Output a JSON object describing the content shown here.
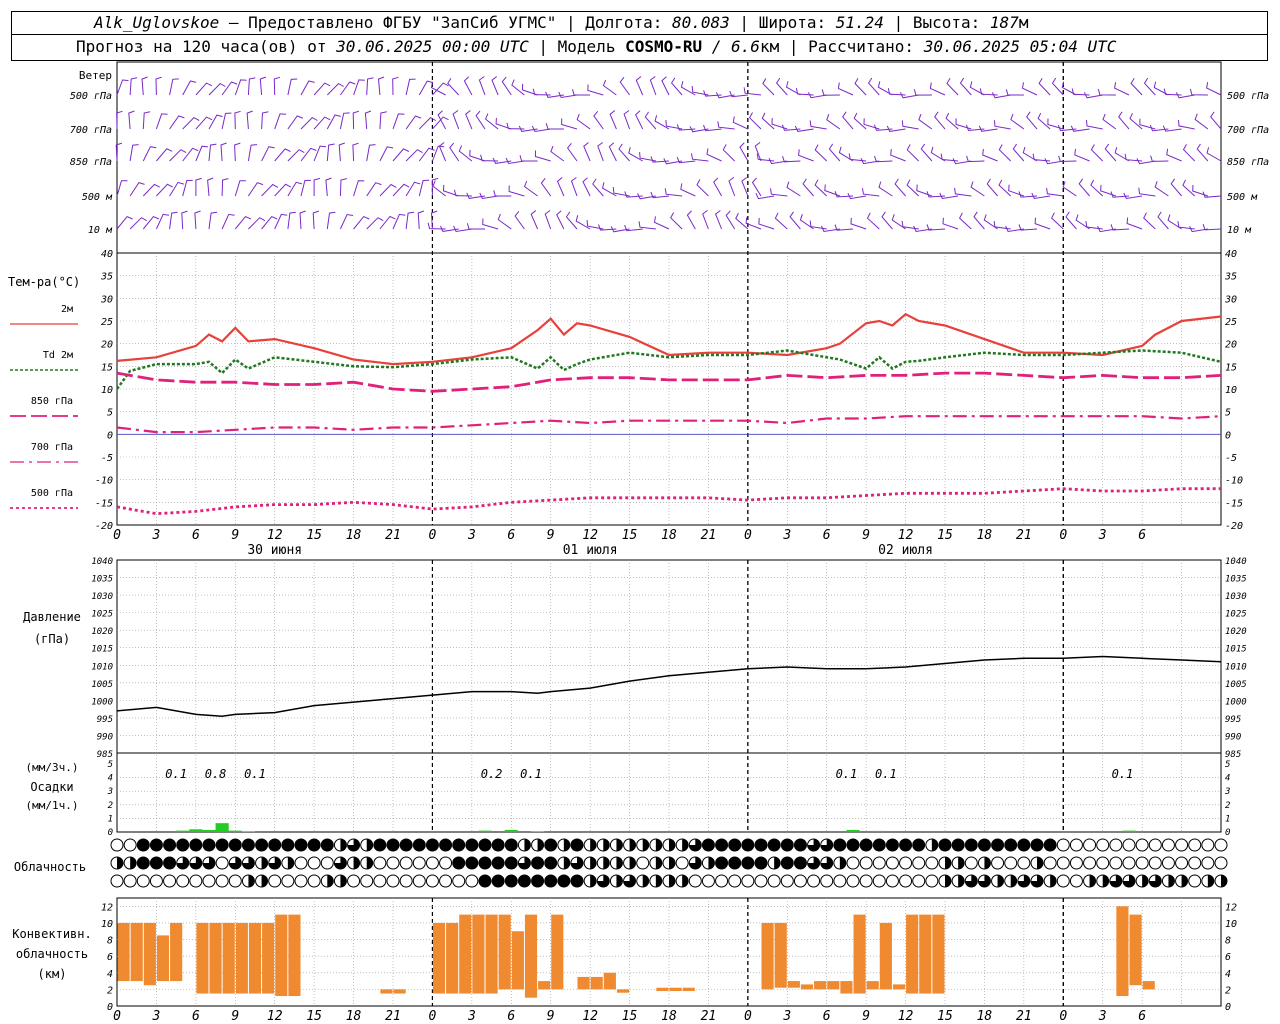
{
  "header": {
    "station": "Alk_Uglovskoe",
    "dash": " – ",
    "provider": "Предоставлено ФГБУ \"ЗапСиб УГМС\"",
    "sep": " | ",
    "lon_label": "Долгота: ",
    "lon_value": "80.083",
    "lat_label": "Широта: ",
    "lat_value": "51.24",
    "alt_label": "Высота: ",
    "alt_value": "187",
    "alt_unit": "м"
  },
  "subheader": {
    "forecast_prefix": "Прогноз на 120 часа(ов) от ",
    "run_time": "30.06.2025 00:00 UTC",
    "model_label": "  | Модель ",
    "model_name": "COSMO-RU",
    "model_res": " / 6.6",
    "model_res_unit": "км",
    "calc_label": " | Рассчитано: ",
    "calc_time": "30.06.2025 05:04 UTC"
  },
  "colors": {
    "wind": "#7a28c8",
    "t2m": "#e8403a",
    "td2m": "#1f7a1f",
    "t850": "#e0207a",
    "t700": "#e0207a",
    "t500": "#e0207a",
    "zero_line": "#4040c0",
    "pressure": "#000000",
    "precip": "#22cc22",
    "convective": "#f08a30",
    "grid": "#9a9a9a"
  },
  "time_axis": {
    "hour_ticks": [
      "0",
      "3",
      "6",
      "9",
      "12",
      "15",
      "18",
      "21",
      "0",
      "3",
      "6",
      "9",
      "12",
      "15",
      "18",
      "21",
      "0",
      "3",
      "6",
      "9",
      "12",
      "15",
      "18",
      "21",
      "0",
      "3",
      "6"
    ],
    "day_labels": [
      "30 июня",
      "01 июля",
      "02 июля"
    ]
  },
  "wind_panel": {
    "title": "Ветер",
    "levels": [
      "500 гПа",
      "700 гПа",
      "850 гПа",
      "500  м",
      "10  м"
    ],
    "icons": [
      "wind-barbs-icon"
    ]
  },
  "temp_panel": {
    "title": "Тем-ра(°C)",
    "legend": [
      {
        "key": "t2m",
        "label": "2м"
      },
      {
        "key": "td2m",
        "label_prefix": "Td",
        "label": " 2м"
      },
      {
        "key": "t850",
        "label": "850 гПа"
      },
      {
        "key": "t700",
        "label": "700 гПа"
      },
      {
        "key": "t500",
        "label": "500 гПа"
      }
    ],
    "yticks": [
      "40",
      "35",
      "30",
      "25",
      "20",
      "15",
      "10",
      "5",
      "0",
      "-5",
      "-10",
      "-15",
      "-20"
    ]
  },
  "pressure_panel": {
    "title1": "Давление",
    "title2": "(гПа)",
    "yticks": [
      "1040",
      "1035",
      "1030",
      "1025",
      "1020",
      "1015",
      "1010",
      "1005",
      "1000",
      "995",
      "990",
      "985"
    ]
  },
  "precip_panel": {
    "title1": "(мм/3ч.)",
    "title2": "Осадки",
    "title3": "(мм/1ч.)",
    "yticks": [
      "5",
      "4",
      "3",
      "2",
      "1",
      "0"
    ],
    "annotations": [
      {
        "hour": 4.5,
        "text": "0.1"
      },
      {
        "hour": 7.5,
        "text": "0.8"
      },
      {
        "hour": 10.5,
        "text": "0.1"
      },
      {
        "hour": 28.5,
        "text": "0.2"
      },
      {
        "hour": 31.5,
        "text": "0.1"
      },
      {
        "hour": 55.5,
        "text": "0.1"
      },
      {
        "hour": 58.5,
        "text": "0.1"
      },
      {
        "hour": 76.5,
        "text": "0.1"
      }
    ]
  },
  "cloud_panel": {
    "title": "Облачность",
    "rows": [
      "OOFFFFFFFFFFFFFFFHCHFFFFFFFFFFFHHFHFHHHHHHHHCFFFFFFFFCCFFFFFFFHFFFFFFFFFOOOOOOOOOOOO",
      "HHFFFCCCOCCHCHOOOCHHOOOOOOFFFFFCFFHCHHHHOHHOCHFFFFHFFCCHOOOOOOOHHOHOOOHOOOOOOOOOOOOOOC",
      "OOOOOOOOOOHHOOOOHHOOOOOOOOOOFFFFFFFFHCHCHHHHOOOOOOOOOOOOOOOOOOOHHCCHHCCHOOHHCCHCHHOHHFF"
    ]
  },
  "conv_panel": {
    "title1": "Конвективн.",
    "title2": "облачность",
    "title3": "(км)",
    "yticks": [
      "12",
      "10",
      "8",
      "6",
      "4",
      "2",
      "0"
    ]
  },
  "chart_data": [
    {
      "type": "line",
      "name": "temperature",
      "x_unit": "hours since 30.06.2025 00:00 UTC",
      "ylim": [
        -20,
        40
      ],
      "series": [
        {
          "name": "2м",
          "x": [
            0,
            3,
            6,
            7,
            8,
            9,
            10,
            12,
            15,
            18,
            21,
            24,
            27,
            30,
            32,
            33,
            34,
            35,
            36,
            39,
            42,
            45,
            48,
            51,
            54,
            55,
            57,
            58,
            59,
            60,
            61,
            63,
            66,
            69,
            72,
            75,
            78,
            79,
            81,
            84
          ],
          "values": [
            16.2,
            17,
            19.5,
            22,
            20.5,
            23.5,
            20.5,
            21,
            19,
            16.5,
            15.5,
            16,
            17,
            19,
            23,
            25.5,
            22,
            24.5,
            24,
            21.5,
            17.5,
            18,
            18,
            17.5,
            19,
            20,
            24.5,
            25,
            24,
            26.5,
            25,
            24,
            21,
            18,
            18,
            17.5,
            19.5,
            22,
            25,
            26
          ]
        },
        {
          "name": "Td 2м",
          "x": [
            0,
            1,
            3,
            6,
            7,
            8,
            9,
            10,
            12,
            15,
            18,
            21,
            24,
            27,
            30,
            32,
            33,
            34,
            35,
            36,
            39,
            42,
            45,
            48,
            51,
            54,
            55,
            57,
            58,
            59,
            60,
            61,
            63,
            66,
            69,
            72,
            75,
            78,
            81,
            84
          ],
          "values": [
            10,
            14,
            15.5,
            15.5,
            16,
            13.5,
            16.5,
            14.5,
            17,
            16,
            15,
            14.8,
            15.5,
            16.5,
            17,
            14.5,
            17,
            14.2,
            15.5,
            16.5,
            18,
            17,
            17.5,
            17.5,
            18.5,
            17,
            16.5,
            14.5,
            17,
            14.5,
            16,
            16.2,
            17,
            18,
            17.5,
            17.5,
            18,
            18.5,
            18,
            16
          ]
        },
        {
          "name": "850 гПа",
          "x": [
            0,
            3,
            6,
            9,
            12,
            15,
            18,
            21,
            24,
            27,
            30,
            33,
            36,
            39,
            42,
            45,
            48,
            51,
            54,
            57,
            60,
            63,
            66,
            69,
            72,
            75,
            78,
            81,
            84
          ],
          "values": [
            13.5,
            12,
            11.5,
            11.5,
            11,
            11,
            11.5,
            10,
            9.5,
            10,
            10.5,
            12,
            12.5,
            12.5,
            12,
            12,
            12,
            13,
            12.5,
            13,
            13,
            13.5,
            13.5,
            13,
            12.5,
            13,
            12.5,
            12.5,
            13
          ]
        },
        {
          "name": "700 гПа",
          "x": [
            0,
            3,
            6,
            9,
            12,
            15,
            18,
            21,
            24,
            27,
            30,
            33,
            36,
            39,
            42,
            45,
            48,
            51,
            54,
            57,
            60,
            63,
            66,
            69,
            72,
            75,
            78,
            81,
            84
          ],
          "values": [
            1.5,
            0.5,
            0.5,
            1,
            1.5,
            1.5,
            1,
            1.5,
            1.5,
            2,
            2.5,
            3,
            2.5,
            3,
            3,
            3,
            3,
            2.5,
            3.5,
            3.5,
            4,
            4,
            4,
            4,
            4,
            4,
            4,
            3.5,
            4
          ]
        },
        {
          "name": "500 гПа",
          "x": [
            0,
            3,
            6,
            9,
            12,
            15,
            18,
            21,
            24,
            27,
            30,
            33,
            36,
            39,
            42,
            45,
            48,
            51,
            54,
            57,
            60,
            63,
            66,
            69,
            72,
            75,
            78,
            81,
            84
          ],
          "values": [
            -16,
            -17.5,
            -17,
            -16,
            -15.5,
            -15.5,
            -15,
            -15.5,
            -16.5,
            -16,
            -15,
            -14.5,
            -14,
            -14,
            -14,
            -14,
            -14.5,
            -14,
            -14,
            -13.5,
            -13,
            -13,
            -13,
            -12.5,
            -12,
            -12.5,
            -12.5,
            -12,
            -12
          ]
        }
      ]
    },
    {
      "type": "line",
      "name": "pressure",
      "x_unit": "hours since 30.06.2025 00:00 UTC",
      "ylim": [
        985,
        1040
      ],
      "series": [
        {
          "name": "pressure",
          "x": [
            0,
            3,
            6,
            8,
            9,
            12,
            15,
            18,
            21,
            24,
            27,
            30,
            32,
            33,
            36,
            39,
            42,
            45,
            48,
            51,
            54,
            57,
            60,
            63,
            66,
            69,
            72,
            75,
            78,
            81,
            84
          ],
          "values": [
            997,
            998,
            996,
            995.5,
            996,
            996.5,
            998.5,
            999.5,
            1000.5,
            1001.5,
            1002.5,
            1002.5,
            1002,
            1002.5,
            1003.5,
            1005.5,
            1007,
            1008,
            1009,
            1009.5,
            1009,
            1009,
            1009.5,
            1010.5,
            1011.5,
            1012,
            1012,
            1012.5,
            1012,
            1011.5,
            1011
          ]
        }
      ]
    },
    {
      "type": "bar",
      "name": "precipitation_1h",
      "x_unit": "hours since 30.06.2025 00:00 UTC",
      "ylim": [
        0,
        5
      ],
      "x": [
        5,
        6,
        7,
        8,
        9,
        10,
        28,
        30,
        32,
        56,
        58,
        77
      ],
      "values": [
        0.1,
        0.2,
        0.15,
        0.65,
        0.1,
        0.05,
        0.1,
        0.15,
        0.05,
        0.15,
        0.08,
        0.1
      ]
    },
    {
      "type": "bar",
      "name": "convective_clouds",
      "x_unit": "hours since 30.06.2025 00:00 UTC",
      "ylim": [
        0,
        13
      ],
      "bars": [
        {
          "x": 0,
          "bottom": 3,
          "top": 10
        },
        {
          "x": 1,
          "bottom": 3,
          "top": 10
        },
        {
          "x": 2,
          "bottom": 2.5,
          "top": 10
        },
        {
          "x": 3,
          "bottom": 3,
          "top": 8.5
        },
        {
          "x": 4,
          "bottom": 3,
          "top": 10
        },
        {
          "x": 6,
          "bottom": 1.5,
          "top": 10
        },
        {
          "x": 7,
          "bottom": 1.5,
          "top": 10
        },
        {
          "x": 8,
          "bottom": 1.5,
          "top": 10
        },
        {
          "x": 9,
          "bottom": 1.5,
          "top": 10
        },
        {
          "x": 10,
          "bottom": 1.5,
          "top": 10
        },
        {
          "x": 11,
          "bottom": 1.5,
          "top": 10
        },
        {
          "x": 12,
          "bottom": 1.2,
          "top": 11
        },
        {
          "x": 13,
          "bottom": 1.2,
          "top": 11
        },
        {
          "x": 20,
          "bottom": 1.5,
          "top": 2
        },
        {
          "x": 21,
          "bottom": 1.5,
          "top": 2
        },
        {
          "x": 24,
          "bottom": 1.5,
          "top": 10
        },
        {
          "x": 25,
          "bottom": 1.5,
          "top": 10
        },
        {
          "x": 26,
          "bottom": 1.5,
          "top": 11
        },
        {
          "x": 27,
          "bottom": 1.5,
          "top": 11
        },
        {
          "x": 28,
          "bottom": 1.5,
          "top": 11
        },
        {
          "x": 29,
          "bottom": 2,
          "top": 11
        },
        {
          "x": 30,
          "bottom": 2,
          "top": 9
        },
        {
          "x": 31,
          "bottom": 1,
          "top": 11
        },
        {
          "x": 32,
          "bottom": 2,
          "top": 3
        },
        {
          "x": 33,
          "bottom": 2,
          "top": 11
        },
        {
          "x": 35,
          "bottom": 2,
          "top": 3.5
        },
        {
          "x": 36,
          "bottom": 2,
          "top": 3.5
        },
        {
          "x": 37,
          "bottom": 2,
          "top": 4
        },
        {
          "x": 38,
          "bottom": 1.6,
          "top": 2
        },
        {
          "x": 41,
          "bottom": 1.8,
          "top": 2.2
        },
        {
          "x": 42,
          "bottom": 1.8,
          "top": 2.2
        },
        {
          "x": 43,
          "bottom": 1.8,
          "top": 2.2
        },
        {
          "x": 49,
          "bottom": 2,
          "top": 10
        },
        {
          "x": 50,
          "bottom": 2.2,
          "top": 10
        },
        {
          "x": 51,
          "bottom": 2.2,
          "top": 3
        },
        {
          "x": 52,
          "bottom": 2,
          "top": 2.6
        },
        {
          "x": 53,
          "bottom": 2,
          "top": 3
        },
        {
          "x": 54,
          "bottom": 2,
          "top": 3
        },
        {
          "x": 55,
          "bottom": 1.5,
          "top": 3
        },
        {
          "x": 56,
          "bottom": 1.5,
          "top": 11
        },
        {
          "x": 57,
          "bottom": 2,
          "top": 3
        },
        {
          "x": 58,
          "bottom": 2,
          "top": 10
        },
        {
          "x": 59,
          "bottom": 2,
          "top": 2.6
        },
        {
          "x": 60,
          "bottom": 1.5,
          "top": 11
        },
        {
          "x": 61,
          "bottom": 1.5,
          "top": 11
        },
        {
          "x": 62,
          "bottom": 1.5,
          "top": 11
        },
        {
          "x": 76,
          "bottom": 1.2,
          "top": 12
        },
        {
          "x": 77,
          "bottom": 2.5,
          "top": 11
        },
        {
          "x": 78,
          "bottom": 2,
          "top": 3
        }
      ]
    }
  ]
}
